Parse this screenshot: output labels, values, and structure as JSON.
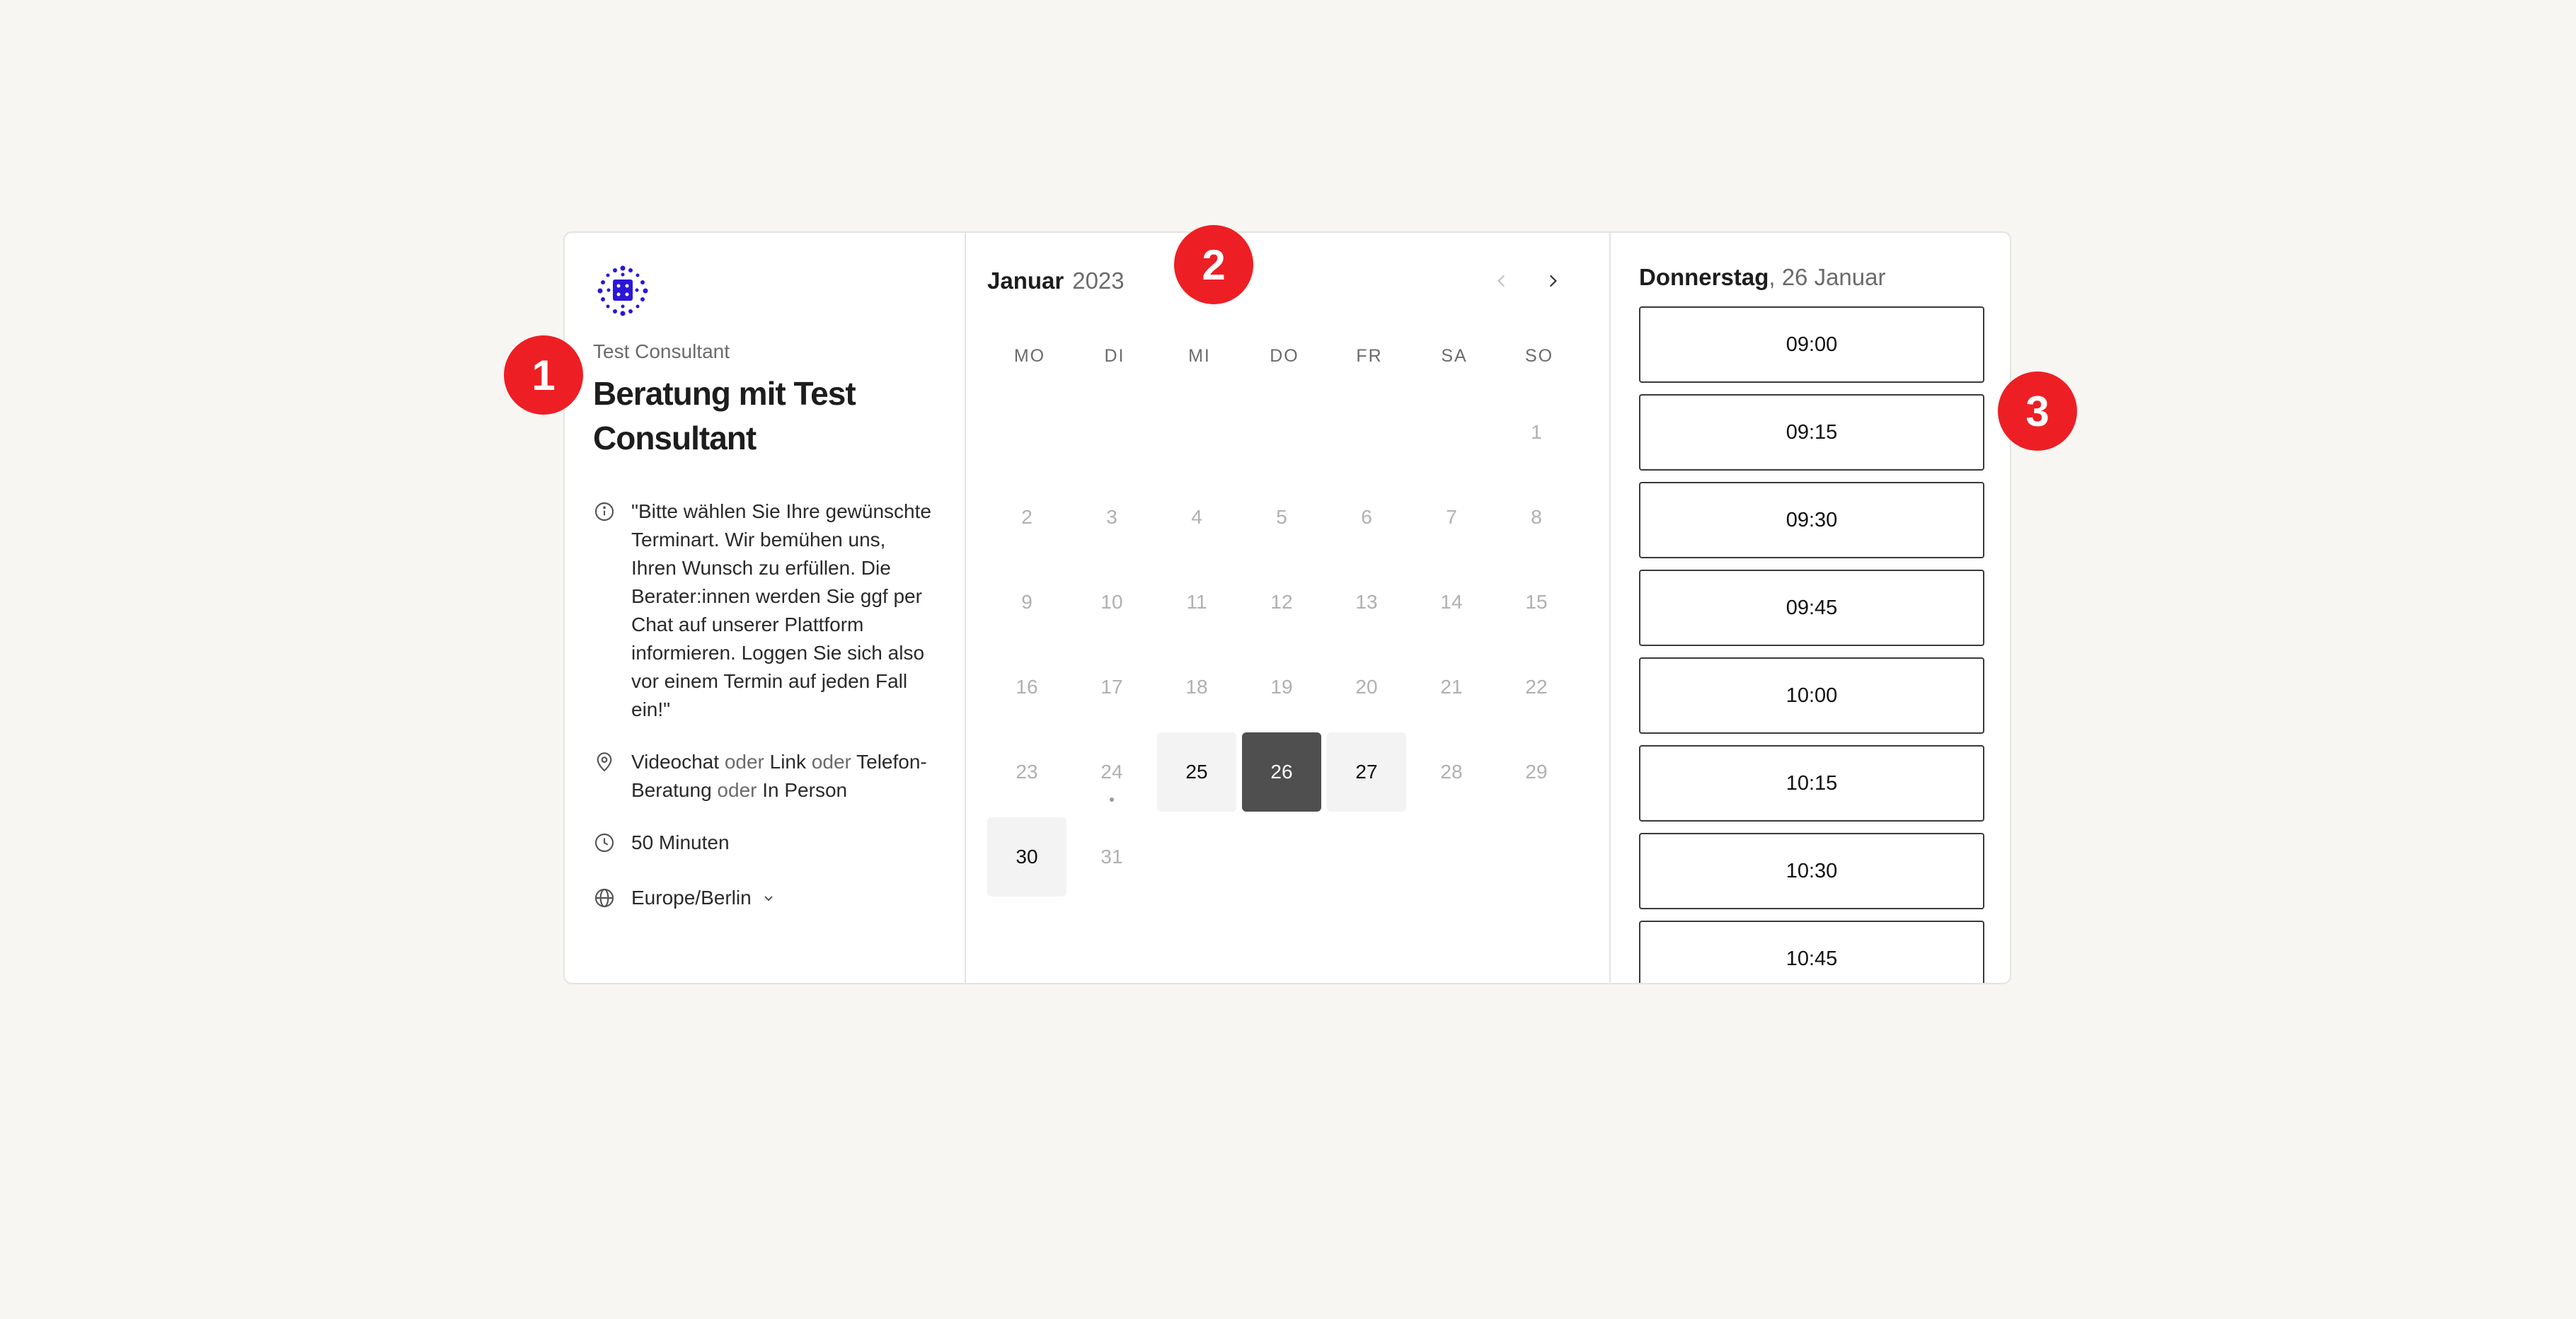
{
  "info": {
    "consultant": "Test Consultant",
    "title": "Beratung mit Test Consultant",
    "description": "\"Bitte wählen Sie Ihre gewünschte Terminart. Wir bemühen uns, Ihren Wunsch zu erfüllen. Die Berater:innen werden Sie ggf per Chat auf unserer Plattform informieren. Loggen Sie sich also vor einem Termin auf jeden Fall ein!\"",
    "locations": {
      "opt1": "Videochat",
      "sep1": "oder",
      "opt2": "Link",
      "sep2": "oder",
      "opt3": "Telefon-Beratung",
      "sep3": "oder",
      "opt4": "In Person"
    },
    "duration": "50 Minuten",
    "timezone": "Europe/Berlin"
  },
  "calendar": {
    "month": "Januar",
    "year": "2023",
    "weekdays": [
      "MO",
      "DI",
      "MI",
      "DO",
      "FR",
      "SA",
      "SO"
    ],
    "days": [
      {
        "label": "",
        "state": "blank"
      },
      {
        "label": "",
        "state": "blank"
      },
      {
        "label": "",
        "state": "blank"
      },
      {
        "label": "",
        "state": "blank"
      },
      {
        "label": "",
        "state": "blank"
      },
      {
        "label": "",
        "state": "blank"
      },
      {
        "label": "1",
        "state": "disabled"
      },
      {
        "label": "2",
        "state": "disabled"
      },
      {
        "label": "3",
        "state": "disabled"
      },
      {
        "label": "4",
        "state": "disabled"
      },
      {
        "label": "5",
        "state": "disabled"
      },
      {
        "label": "6",
        "state": "disabled"
      },
      {
        "label": "7",
        "state": "disabled"
      },
      {
        "label": "8",
        "state": "disabled"
      },
      {
        "label": "9",
        "state": "disabled"
      },
      {
        "label": "10",
        "state": "disabled"
      },
      {
        "label": "11",
        "state": "disabled"
      },
      {
        "label": "12",
        "state": "disabled"
      },
      {
        "label": "13",
        "state": "disabled"
      },
      {
        "label": "14",
        "state": "disabled"
      },
      {
        "label": "15",
        "state": "disabled"
      },
      {
        "label": "16",
        "state": "disabled"
      },
      {
        "label": "17",
        "state": "disabled"
      },
      {
        "label": "18",
        "state": "disabled"
      },
      {
        "label": "19",
        "state": "disabled"
      },
      {
        "label": "20",
        "state": "disabled"
      },
      {
        "label": "21",
        "state": "disabled"
      },
      {
        "label": "22",
        "state": "disabled"
      },
      {
        "label": "23",
        "state": "disabled"
      },
      {
        "label": "24",
        "state": "today"
      },
      {
        "label": "25",
        "state": "available"
      },
      {
        "label": "26",
        "state": "selected"
      },
      {
        "label": "27",
        "state": "available"
      },
      {
        "label": "28",
        "state": "disabled"
      },
      {
        "label": "29",
        "state": "disabled"
      },
      {
        "label": "30",
        "state": "available"
      },
      {
        "label": "31",
        "state": "disabled"
      }
    ]
  },
  "slots": {
    "weekday": "Donnerstag",
    "date": ", 26 Januar",
    "times": [
      "09:00",
      "09:15",
      "09:30",
      "09:45",
      "10:00",
      "10:15",
      "10:30",
      "10:45"
    ]
  },
  "markers": [
    "1",
    "2",
    "3"
  ],
  "colors": {
    "background": "#f8f6f2",
    "selected_day": "#4f4f4f",
    "available_day": "#f3f3f3",
    "marker": "#ed1f24",
    "logo": "#2d16d8"
  }
}
